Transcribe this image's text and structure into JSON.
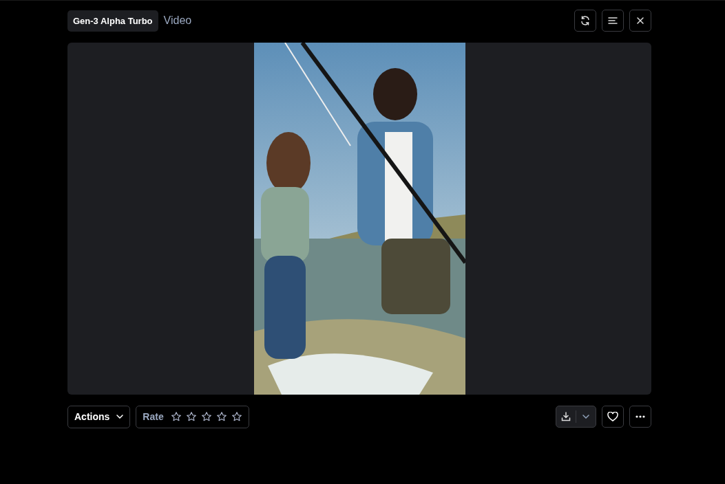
{
  "header": {
    "model": "Gen-3 Alpha Turbo",
    "type": "Video"
  },
  "footer": {
    "actions": "Actions",
    "rate_label": "Rate",
    "stars": 0
  }
}
